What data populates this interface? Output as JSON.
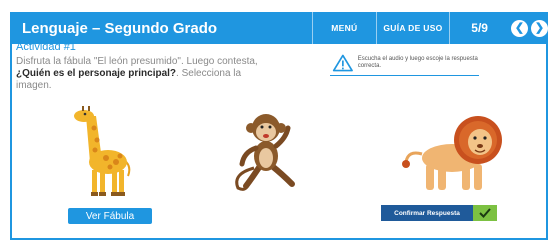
{
  "header": {
    "title": "Lenguaje – Segundo Grado",
    "menu_label": "MENÚ",
    "guide_label": "GUÍA DE USO",
    "page_indicator": "5/9",
    "prev_icon": "chevron-left-icon",
    "next_icon": "chevron-right-icon"
  },
  "activity": {
    "title": "Actividad #1",
    "instruction_plain": "Disfruta la fábula \"El león presumido\". Luego contesta, ",
    "instruction_bold": "¿Quién es el personaje principal?",
    "instruction_tail": ". Selecciona la imagen."
  },
  "hint": {
    "icon": "warning-icon",
    "text": "Escucha el audio y luego escoje la respuesta correcta."
  },
  "options": [
    {
      "name": "giraffe",
      "icon": "giraffe-image"
    },
    {
      "name": "monkey",
      "icon": "monkey-image"
    },
    {
      "name": "lion",
      "icon": "lion-image"
    }
  ],
  "buttons": {
    "ver_fabula": "Ver Fábula",
    "confirmar": "Confirmar Respuesta",
    "confirm_icon": "checkmark-icon"
  },
  "colors": {
    "primary": "#1f96e0",
    "confirm_dark": "#1f5a9a",
    "confirm_green": "#7cc142"
  }
}
